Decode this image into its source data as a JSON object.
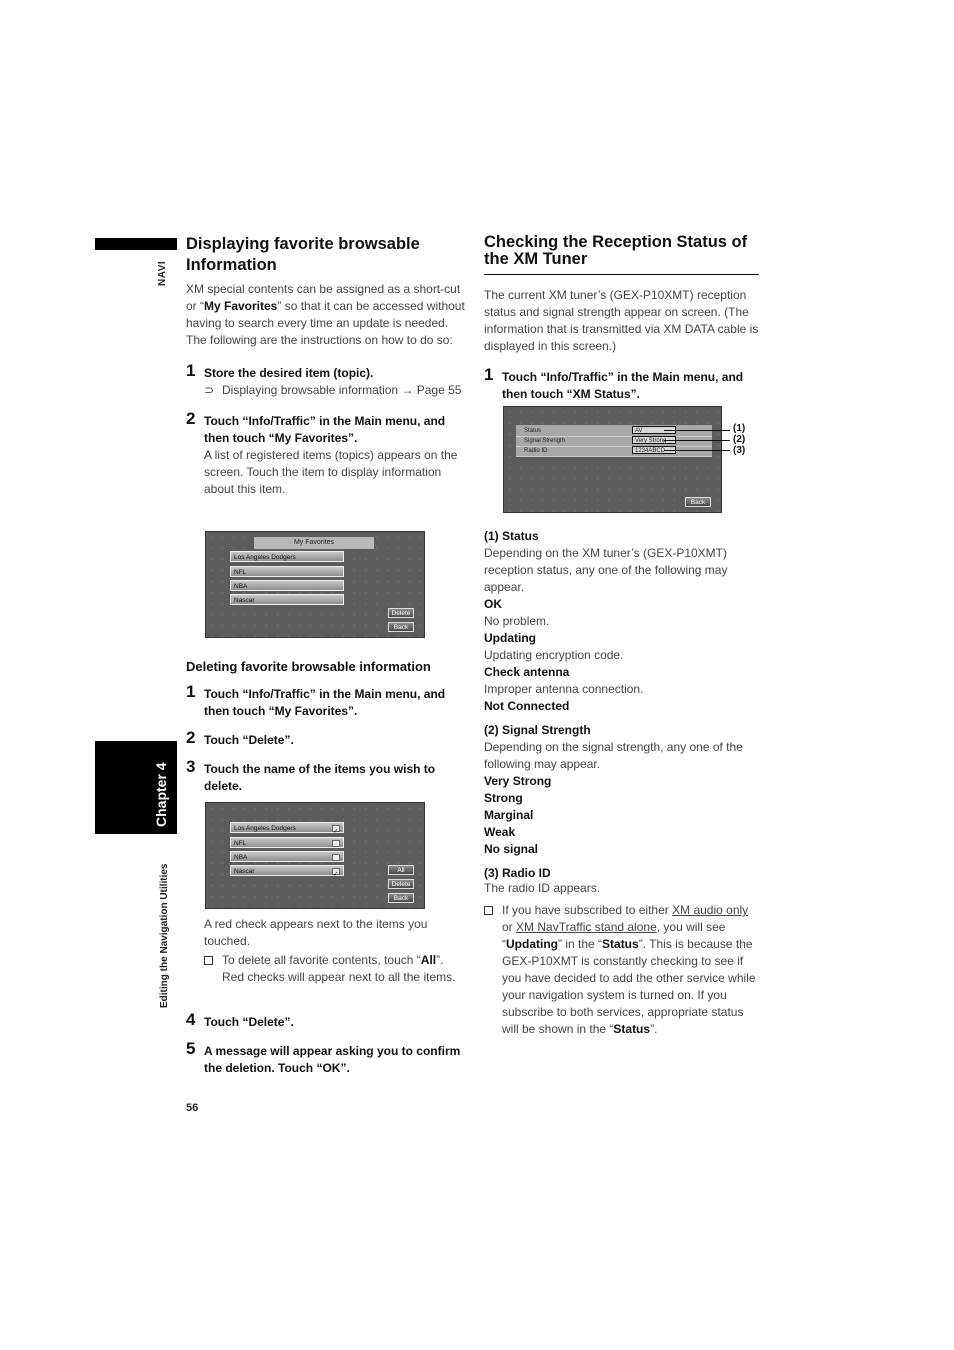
{
  "side": {
    "navi_label": "NAVI",
    "chapter_label": "Chapter 4",
    "section_label": "Editing the Navigation Utilities",
    "page_number": "56"
  },
  "left": {
    "title": "Displaying favorite browsable Information",
    "intro_parts": [
      "XM special contents can be assigned as a short-cut or “",
      "My Favorites",
      "” so that it can be accessed without having to search every time an update is needed. The following are the instructions on how to do so:"
    ],
    "steps": [
      {
        "num": "1",
        "instr": "Store the desired item (topic).",
        "ref_glyph": "⊃",
        "ref_text": "Displaying browsable information → Page 55"
      },
      {
        "num": "2",
        "instr": "Touch “Info/Traffic” in the Main menu, and then touch “My Favorites”.",
        "detail": "A list of registered items (topics) appears on the screen. Touch the item to display information about this item."
      }
    ],
    "screen1": {
      "title": "My Favorites",
      "items": [
        "Los Angeles Dodgers",
        "NFL",
        "NBA",
        "Nascar"
      ],
      "buttons": [
        "Delete",
        "Back"
      ]
    },
    "delete_heading": "Deleting favorite browsable information",
    "delete_steps": [
      {
        "num": "1",
        "instr": "Touch “Info/Traffic” in the Main menu, and then touch “My Favorites”."
      },
      {
        "num": "2",
        "instr": "Touch “Delete”."
      },
      {
        "num": "3",
        "instr": "Touch the name of the items you wish to delete."
      },
      {
        "num": "4",
        "instr": "Touch “Delete”."
      },
      {
        "num": "5",
        "instr": "A message will appear asking you to confirm the deletion. Touch “OK”."
      }
    ],
    "screen2": {
      "items": [
        {
          "label": "Los Angeles Dodgers",
          "checked": true
        },
        {
          "label": "NFL",
          "checked": false
        },
        {
          "label": "NBA",
          "checked": false
        },
        {
          "label": "Nascar",
          "checked": true
        }
      ],
      "buttons": [
        "All",
        "Delete",
        "Back"
      ]
    },
    "after_step3": "A red check appears next to the items you touched.",
    "note_parts": [
      "To delete all favorite contents, touch “",
      "All",
      "”. Red checks will appear next to all the items."
    ]
  },
  "right": {
    "title": "Checking the Reception Status of the XM Tuner",
    "intro": "The current XM tuner’s (GEX-P10XMT) reception status and signal strength appear on screen. (The information that is transmitted via XM DATA cable is displayed in this screen.)",
    "step1": {
      "num": "1",
      "instr": "Touch “Info/Traffic” in the Main menu, and then touch “XM Status”."
    },
    "screen": {
      "rows": [
        {
          "label": "Status",
          "value": "AV",
          "callout": "(1)"
        },
        {
          "label": "Signal Strength",
          "value": "Very Strong",
          "callout": "(2)"
        },
        {
          "label": "Radio ID",
          "value": "1234ABCD",
          "callout": "(3)"
        }
      ],
      "back_button": "Back"
    },
    "status": {
      "heading": "(1) Status",
      "desc": "Depending on the XM tuner’s (GEX-P10XMT) reception status, any one of the following may appear.",
      "items": [
        {
          "term": "OK",
          "desc": "No problem."
        },
        {
          "term": "Updating",
          "desc": "Updating encryption code."
        },
        {
          "term": "Check antenna",
          "desc": "Improper antenna connection."
        },
        {
          "term": "Not Connected",
          "desc": ""
        }
      ]
    },
    "signal": {
      "heading": "(2) Signal Strength",
      "desc": "Depending on the signal strength, any one of the following may appear.",
      "items": [
        "Very Strong",
        "Strong",
        "Marginal",
        "Weak",
        "No signal"
      ]
    },
    "radio_id": {
      "heading": "(3) Radio ID",
      "desc": "The radio ID appears."
    },
    "note": {
      "p1": "If you have subscribed to either ",
      "link1": "XM audio only",
      "p2": " or ",
      "link2": "XM NavTraffic stand alone",
      "p3": ", you will see “",
      "b1": "Updating",
      "p4": "” in the “",
      "b2": "Status",
      "p5": "”. This is because the GEX-P10XMT is constantly checking to see if you have decided to add the other service while your navigation system is turned on. If you subscribe to both services, appropriate status will be shown in the “",
      "b3": "Status",
      "p6": "”."
    }
  }
}
